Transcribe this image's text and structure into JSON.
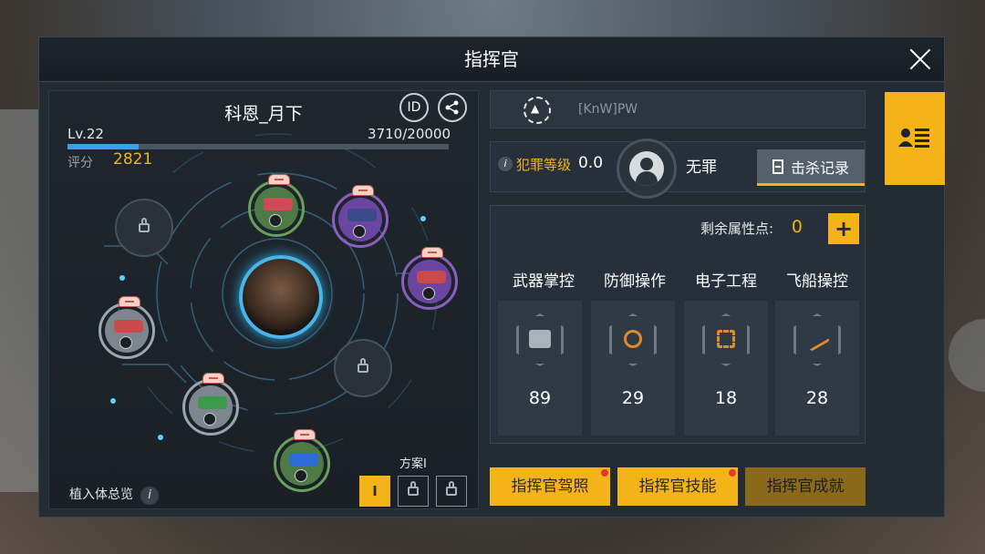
{
  "window": {
    "title": "指挥官"
  },
  "profile": {
    "name": "科恩_月下",
    "id_button": "ID",
    "level": "Lv.22",
    "exp": "3710/20000",
    "exp_fraction": 0.1855,
    "score_label": "评分",
    "score": "2821"
  },
  "implants": {
    "overview_label": "植入体总览",
    "info_glyph": "i",
    "plan_label": "方案I",
    "plan_buttons": [
      "I",
      "lock-icon",
      "lock-icon"
    ],
    "slots": [
      {
        "color": "#6aa05c",
        "part": "#d24a5a",
        "state": "equipped"
      },
      {
        "color": "#8a5fc0",
        "part": "#3a4a8a",
        "state": "equipped"
      },
      {
        "color": "#8a5fc0",
        "part": "#c84a4a",
        "state": "equipped"
      },
      {
        "color": "#aab2ba",
        "part": "#c84a4a",
        "state": "equipped"
      },
      {
        "color": "#aab2ba",
        "part": "#3c9a4a",
        "state": "equipped"
      },
      {
        "color": "#6aa05c",
        "part": "#2c6ad8",
        "state": "equipped"
      },
      {
        "state": "locked"
      },
      {
        "state": "locked"
      }
    ]
  },
  "guild": {
    "name": "[KnW]PW"
  },
  "crime": {
    "label": "犯罪等级",
    "value": "0.0",
    "status": "无罪",
    "kill_log": "击杀记录"
  },
  "attributes": {
    "remaining_label": "剩余属性点:",
    "remaining": "0",
    "plus": "+",
    "items": [
      {
        "name": "武器掌控",
        "value": "89",
        "icon": "weapon-icon",
        "color": "#aab2ba"
      },
      {
        "name": "防御操作",
        "value": "29",
        "icon": "shield-icon",
        "color": "#e08a2c"
      },
      {
        "name": "电子工程",
        "value": "18",
        "icon": "chip-icon",
        "color": "#e08a2c"
      },
      {
        "name": "飞船操控",
        "value": "28",
        "icon": "ship-icon",
        "color": "#e08a2c"
      }
    ]
  },
  "buttons": {
    "license": "指挥官驾照",
    "skills": "指挥官技能",
    "achievements": "指挥官成就"
  }
}
